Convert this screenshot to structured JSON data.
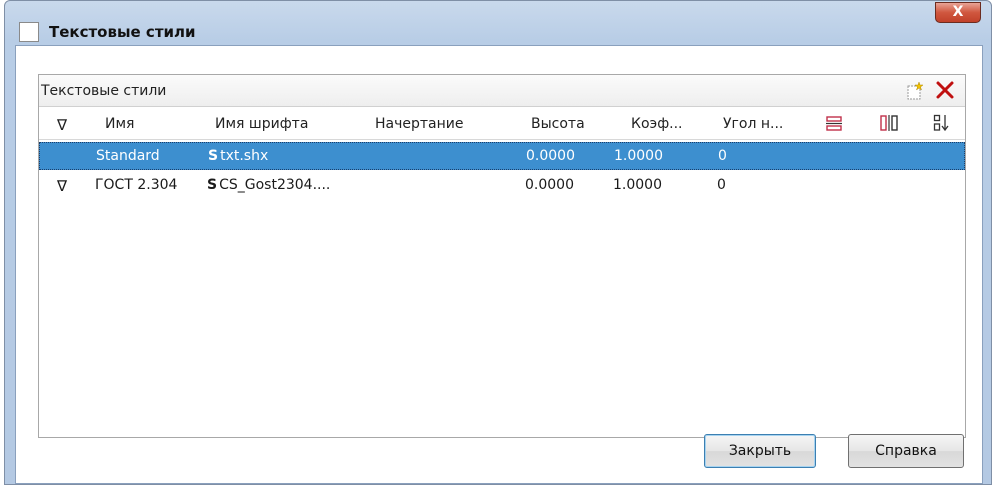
{
  "window": {
    "title": "Текстовые стили",
    "close_glyph": "X"
  },
  "panel": {
    "title": "Текстовые стили"
  },
  "table": {
    "columns": {
      "filter_glyph": "∇",
      "name": "Имя",
      "font_name": "Имя шрифта",
      "style": "Начертание",
      "height": "Высота",
      "factor": "Коэф...",
      "angle": "Угол н..."
    },
    "rows": [
      {
        "filter": "",
        "name": "Standard",
        "font_glyph": "S",
        "font_name": "txt.shx",
        "style": "",
        "height": "0.0000",
        "factor": "1.0000",
        "angle": "0",
        "selected": true
      },
      {
        "filter": "∇",
        "name": "ГОСТ 2.304",
        "font_glyph": "S",
        "font_name": "CS_Gost2304....",
        "style": "",
        "height": "0.0000",
        "factor": "1.0000",
        "angle": "0",
        "selected": false
      }
    ]
  },
  "buttons": {
    "close": "Закрыть",
    "help": "Справка"
  },
  "icons": {
    "title": "window-app-icon",
    "close": "close-icon",
    "new": "new-style-icon",
    "delete": "delete-x-icon",
    "upside_down": "upside-down-icon",
    "backwards": "backwards-icon",
    "vertical": "vertical-icon"
  },
  "colors": {
    "selection": "#3d8fcf",
    "delete": "#c01010",
    "vertical_icon": "#c0304a"
  }
}
